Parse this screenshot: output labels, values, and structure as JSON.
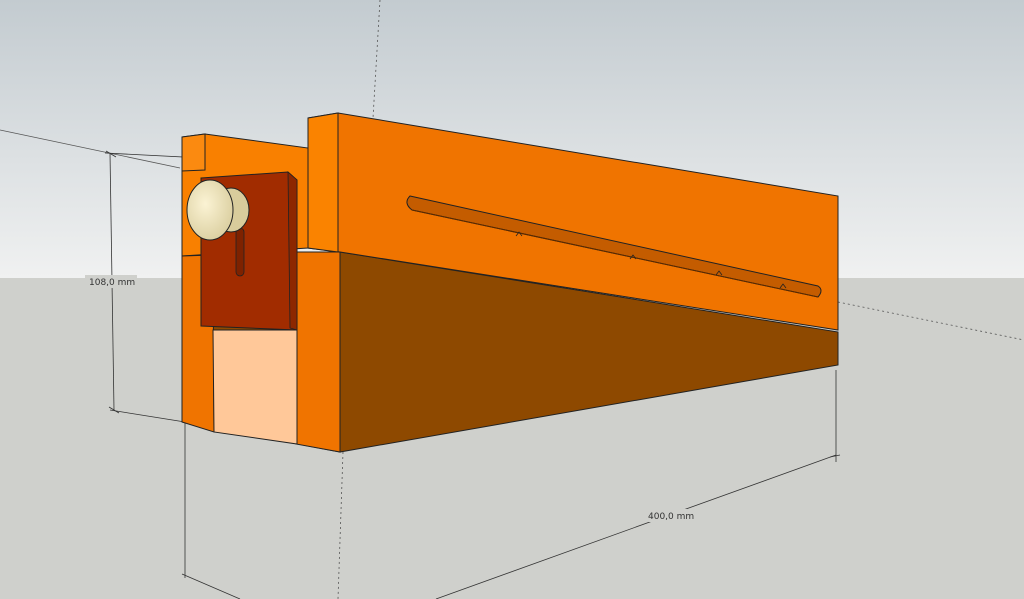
{
  "model_view": {
    "dimensions": {
      "height_label": "108,0 mm",
      "length_label": "400,0 mm"
    },
    "colors": {
      "sky_top": "#c4ccd1",
      "sky_bottom": "#eef0f0",
      "ground": "#cfd0cc",
      "body_orange": "#f07400",
      "front_orange": "#f98000",
      "lower_brown": "#8e4900",
      "clamp_red": "#a12c00",
      "insert_peach": "#ffc899",
      "knob_cream": "#efe3b7"
    }
  }
}
